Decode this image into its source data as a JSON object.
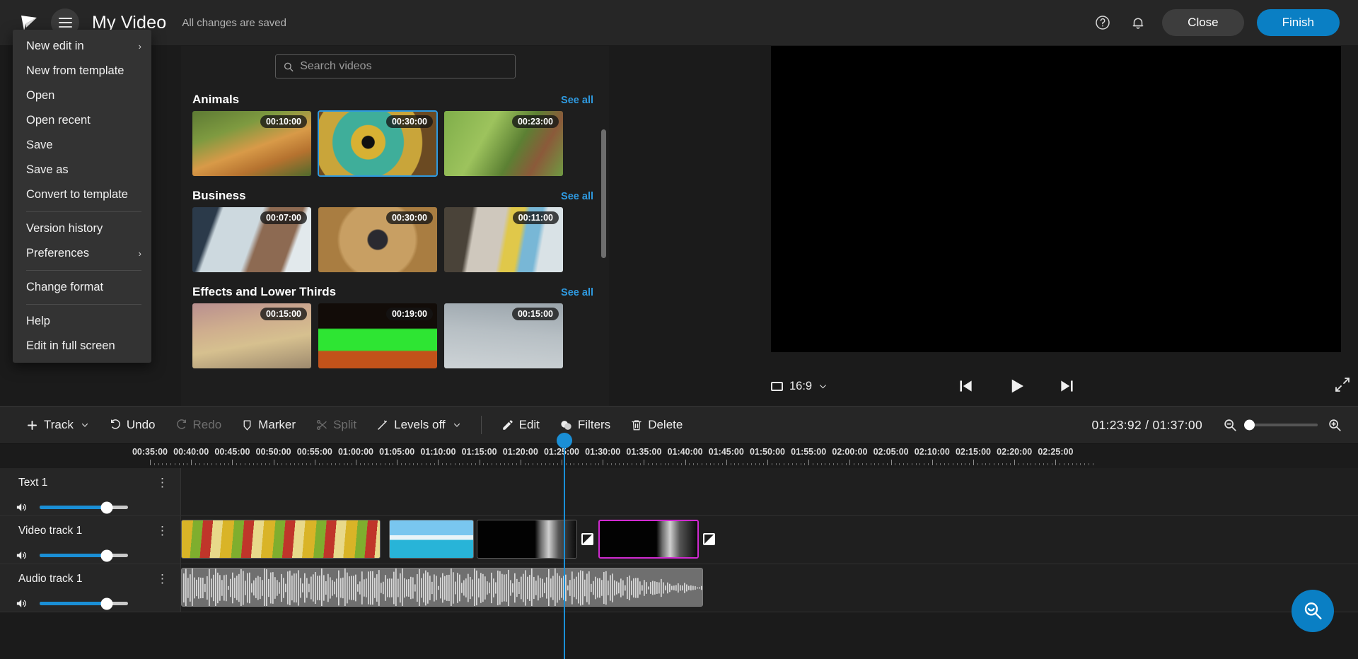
{
  "app": {
    "logo": "play-logo",
    "title": "My Video",
    "save_status": "All changes are saved"
  },
  "topbar": {
    "help_icon": "help-circle-icon",
    "bell_icon": "notification-bell-icon",
    "close_label": "Close",
    "finish_label": "Finish",
    "accent": "#0a7fc4"
  },
  "file_menu": {
    "items": [
      {
        "label": "New edit in",
        "submenu": true,
        "divider_after": false
      },
      {
        "label": "New from template",
        "submenu": false,
        "divider_after": false
      },
      {
        "label": "Open",
        "submenu": false,
        "divider_after": false
      },
      {
        "label": "Open recent",
        "submenu": false,
        "divider_after": false
      },
      {
        "label": "Save",
        "submenu": false,
        "divider_after": false
      },
      {
        "label": "Save as",
        "submenu": false,
        "divider_after": false
      },
      {
        "label": "Convert to template",
        "submenu": false,
        "divider_after": true
      },
      {
        "label": "Version history",
        "submenu": false,
        "divider_after": false
      },
      {
        "label": "Preferences",
        "submenu": true,
        "divider_after": true
      },
      {
        "label": "Change format",
        "submenu": false,
        "divider_after": true
      },
      {
        "label": "Help",
        "submenu": false,
        "divider_after": false
      },
      {
        "label": "Edit in full screen",
        "submenu": false,
        "divider_after": false
      }
    ]
  },
  "library": {
    "search": {
      "placeholder": "Search videos",
      "value": "",
      "icon": "search-icon"
    },
    "see_all_label": "See all",
    "categories": [
      {
        "title": "Animals",
        "items": [
          {
            "duration": "00:10:00",
            "selected": false,
            "art": "tiger"
          },
          {
            "duration": "00:30:00",
            "selected": true,
            "art": "chameleon"
          },
          {
            "duration": "00:23:00",
            "selected": false,
            "art": "ants"
          }
        ]
      },
      {
        "title": "Business",
        "items": [
          {
            "duration": "00:07:00",
            "selected": false,
            "art": "handshake"
          },
          {
            "duration": "00:30:00",
            "selected": false,
            "art": "desk"
          },
          {
            "duration": "00:11:00",
            "selected": false,
            "art": "stickynotes"
          }
        ]
      },
      {
        "title": "Effects and Lower Thirds",
        "items": [
          {
            "duration": "00:15:00",
            "selected": false,
            "art": "sunset"
          },
          {
            "duration": "00:19:00",
            "selected": false,
            "art": "greenscreen"
          },
          {
            "duration": "00:15:00",
            "selected": false,
            "art": "grey"
          }
        ]
      }
    ]
  },
  "player": {
    "aspect_ratio": "16:9",
    "aspect_icon": "frame-icon",
    "chevron_icon": "chevron-down-icon",
    "prev_icon": "skip-previous-icon",
    "play_icon": "play-icon",
    "next_icon": "skip-next-icon",
    "expand_icon": "fullscreen-icon"
  },
  "toolbar": {
    "track_label": "Track",
    "undo_label": "Undo",
    "redo_label": "Redo",
    "marker_label": "Marker",
    "split_label": "Split",
    "levels_label": "Levels off",
    "edit_label": "Edit",
    "filters_label": "Filters",
    "delete_label": "Delete",
    "timecode": "01:23:92 / 01:37:00",
    "zoom_out_icon": "zoom-out-icon",
    "zoom_in_icon": "zoom-in-icon",
    "zoom_value": 0
  },
  "timeline": {
    "ruler_labels": [
      "00:35:00",
      "00:40:00",
      "00:45:00",
      "00:50:00",
      "00:55:00",
      "01:00:00",
      "01:05:00",
      "01:10:00",
      "01:15:00",
      "01:20:00",
      "01:25:00",
      "01:30:00",
      "01:35:00",
      "01:40:00",
      "01:45:00",
      "01:50:00",
      "01:55:00",
      "02:00:00",
      "02:05:00",
      "02:10:00",
      "02:15:00",
      "02:20:00",
      "02:25:00"
    ],
    "playhead_position": "01:23:92",
    "tracks": [
      {
        "name": "Text 1",
        "volume": 76,
        "mute_icon": "volume-icon",
        "menu_icon": "kebab-menu-icon"
      },
      {
        "name": "Video track 1",
        "volume": 76,
        "mute_icon": "volume-icon",
        "menu_icon": "kebab-menu-icon"
      },
      {
        "name": "Audio track 1",
        "volume": 76,
        "mute_icon": "volume-icon",
        "menu_icon": "kebab-menu-icon"
      }
    ]
  },
  "fab": {
    "icon": "search-zoom-icon"
  }
}
